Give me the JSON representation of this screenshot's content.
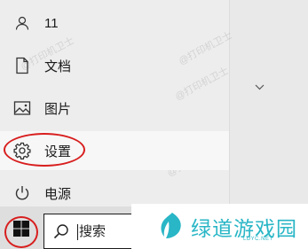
{
  "start_menu": {
    "user_name": "11",
    "items": [
      {
        "label": "文档",
        "icon": "document-icon"
      },
      {
        "label": "图片",
        "icon": "pictures-icon"
      },
      {
        "label": "设置",
        "icon": "gear-icon"
      },
      {
        "label": "电源",
        "icon": "power-icon"
      }
    ]
  },
  "taskbar": {
    "search_placeholder": "搜索"
  },
  "watermark_text": "@打印机卫士",
  "logo": {
    "title": "绿道游戏园",
    "subtitle": "LDYC.NET"
  },
  "colors": {
    "annotation_red": "#d81e1e",
    "logo_teal": "#29b6c6"
  }
}
